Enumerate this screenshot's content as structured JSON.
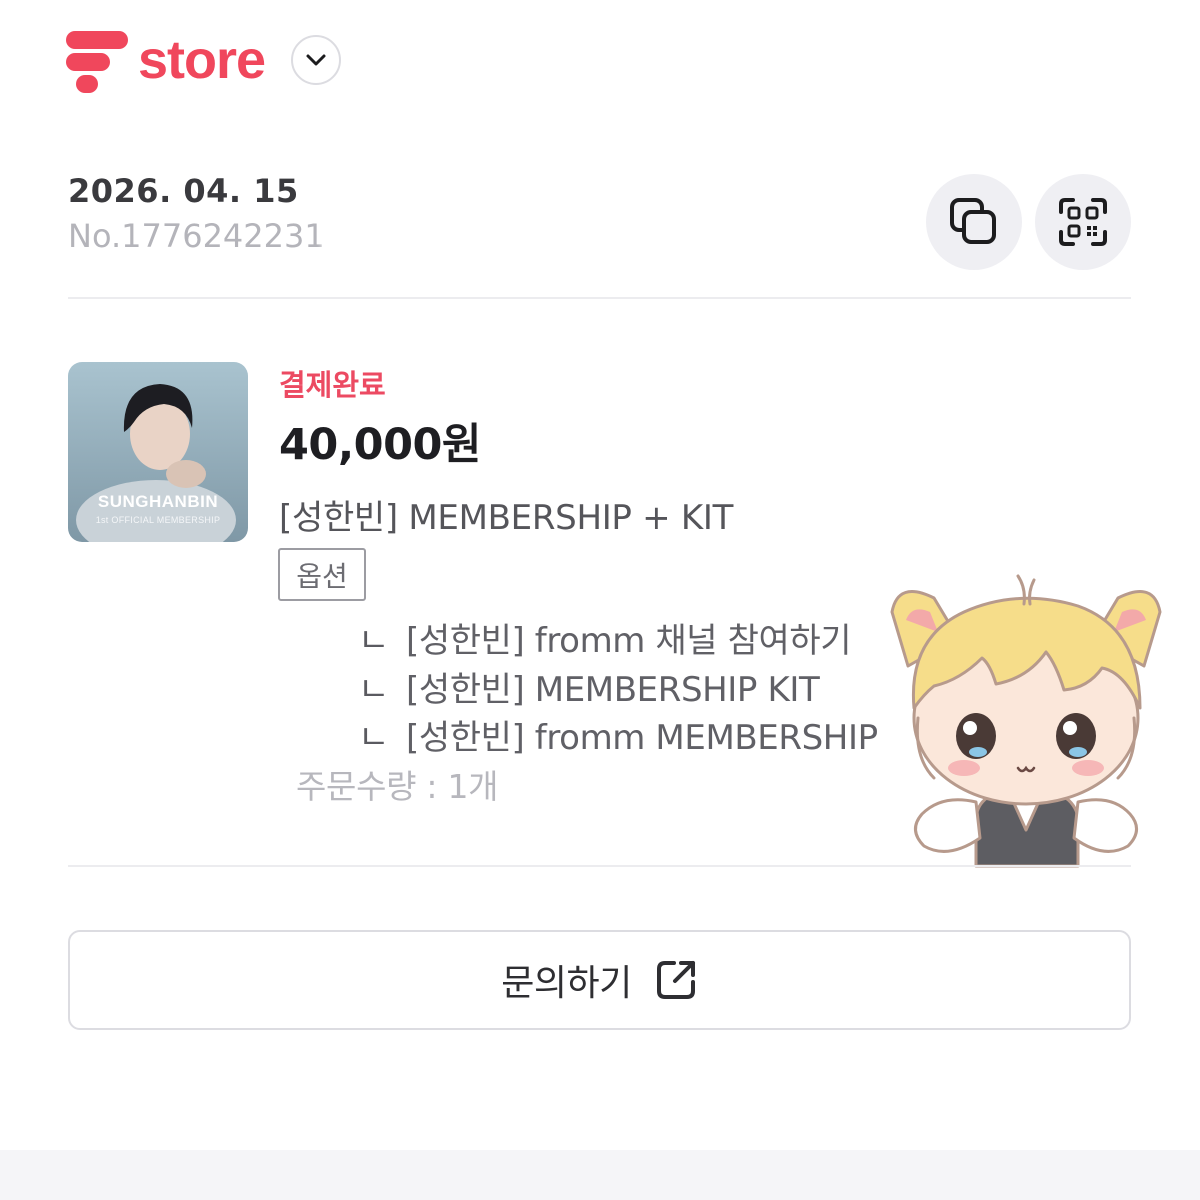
{
  "header": {
    "logo_text": "store",
    "dropdown_icon": "chevron-down-icon",
    "brand_color": "#f0475c"
  },
  "order": {
    "date": "2026. 04. 15",
    "number": "No.1776242231"
  },
  "actions": {
    "copy_icon": "copy-icon",
    "qr_icon": "qr-code-icon"
  },
  "item": {
    "thumbnail": {
      "title": "SUNGHANBIN",
      "subtitle": "1st OFFICIAL MEMBERSHIP"
    },
    "status": "결제완료",
    "status_color": "#ec4a62",
    "price": "40,000원",
    "name": "[성한빈] MEMBERSHIP + KIT",
    "option_badge": "옵션",
    "option_mark": "ㄴ",
    "options": [
      "[성한빈] fromm 채널 참여하기",
      "[성한빈] MEMBERSHIP KIT",
      "[성한빈] fromm MEMBERSHIP"
    ],
    "quantity": "주문수량 : 1개"
  },
  "inquiry": {
    "label": "문의하기",
    "icon": "external-link-icon"
  }
}
